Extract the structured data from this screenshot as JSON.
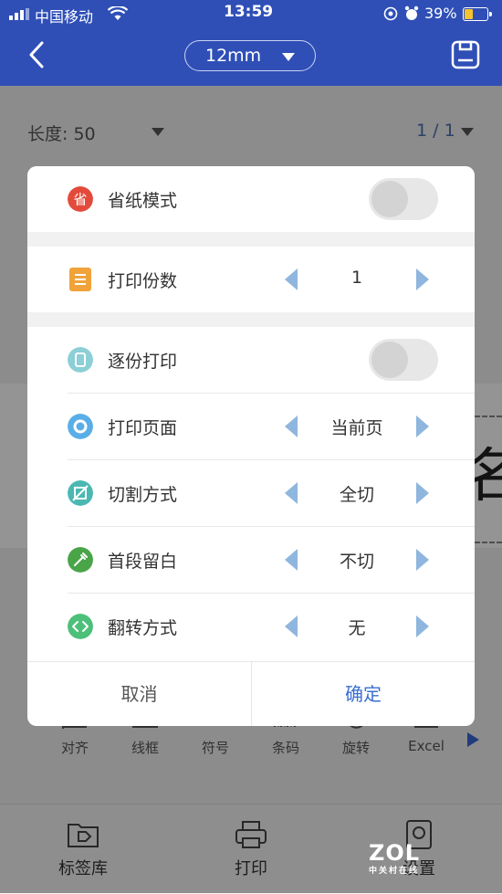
{
  "status_bar": {
    "carrier": "中国移动",
    "time": "13:59",
    "battery": "39%",
    "battery_level": 0.39
  },
  "nav": {
    "size_selector": "12mm"
  },
  "page": {
    "length_label": "长度: 50",
    "pager": "1 / 1",
    "canvas_glyph": "名"
  },
  "toolbar": {
    "items": [
      "对齐",
      "线框",
      "符号",
      "条码",
      "旋转",
      "Excel"
    ]
  },
  "bottom_nav": {
    "items": [
      "标签库",
      "打印",
      "设置"
    ]
  },
  "dialog": {
    "rows": [
      {
        "label": "省纸模式",
        "type": "toggle",
        "on": false,
        "icon": "paper-save-icon",
        "color": "#e24b3b"
      },
      {
        "label": "打印份数",
        "type": "stepper",
        "value": "1",
        "icon": "copies-icon",
        "color": "#f0a33a"
      },
      {
        "label": "逐份打印",
        "type": "toggle",
        "on": false,
        "icon": "collate-icon",
        "color": "#8ccfd6"
      },
      {
        "label": "打印页面",
        "type": "stepper",
        "value": "当前页",
        "icon": "page-icon",
        "color": "#5aaee8"
      },
      {
        "label": "切割方式",
        "type": "stepper",
        "value": "全切",
        "icon": "cut-icon",
        "color": "#4bb8b2"
      },
      {
        "label": "首段留白",
        "type": "stepper",
        "value": "不切",
        "icon": "margin-icon",
        "color": "#4aa548"
      },
      {
        "label": "翻转方式",
        "type": "stepper",
        "value": "无",
        "icon": "flip-icon",
        "color": "#4cc07a"
      }
    ],
    "cancel": "取消",
    "confirm": "确定"
  },
  "watermark": {
    "brand": "ZOL",
    "sub": "中关村在线"
  },
  "colors": {
    "nav_bar": "#2f4fb7",
    "accent": "#3a6fd1",
    "stepper_arrow": "#8fb6de"
  }
}
